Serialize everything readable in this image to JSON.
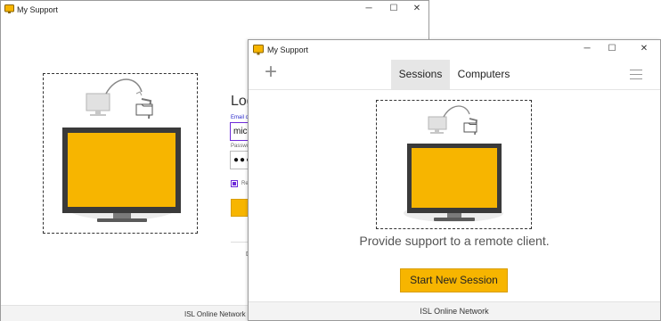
{
  "back_window": {
    "title": "My Support",
    "controls": {
      "minimize": "─",
      "maximize": "☐",
      "close": "✕"
    },
    "login": {
      "title": "Log",
      "email_label": "Email c",
      "email_value": "mic",
      "password_label": "Passwo",
      "password_value": "●●●",
      "remember_label": "Re",
      "footer_text": "D"
    },
    "status": "ISL Online Network",
    "status_icon": "plus-icon"
  },
  "front_window": {
    "title": "My Support",
    "controls": {
      "minimize": "─",
      "maximize": "☐",
      "close": "✕"
    },
    "toolbar": {
      "plus_label": "+",
      "tabs": [
        {
          "label": "Sessions",
          "active": true
        },
        {
          "label": "Computers",
          "active": false
        }
      ],
      "menu_icon": "hamburger-menu-icon"
    },
    "main": {
      "message": "Provide support to a remote client.",
      "start_button": "Start New Session"
    },
    "status": "ISL Online Network"
  },
  "colors": {
    "accent_yellow": "#f7b500",
    "monitor_frame": "#3a3a3a",
    "checkbox_purple": "#6e2bd9"
  }
}
